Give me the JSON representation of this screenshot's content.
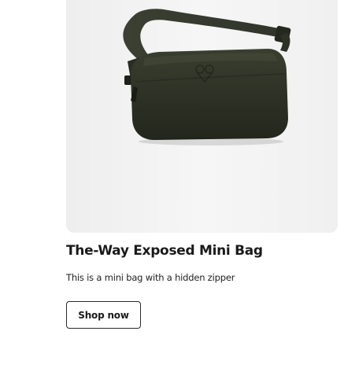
{
  "product": {
    "title": "The-Way Exposed Mini Bag",
    "description": "This is a mini bag with a hidden zipper",
    "cta_label": "Shop now",
    "image_icon": "belt-bag-image",
    "bag_color": "#2f3326",
    "image_background": "#f3f3f3"
  }
}
